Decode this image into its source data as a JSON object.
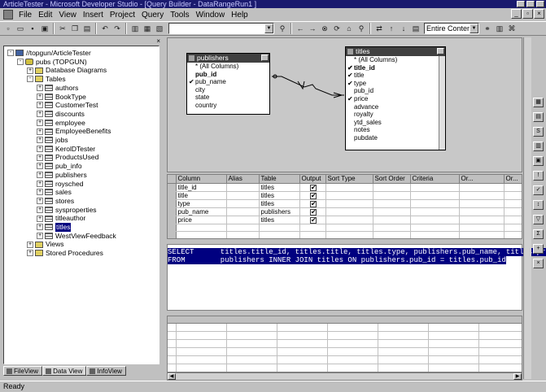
{
  "window": {
    "title": "ArticleTester - Microsoft Developer Studio - [Query Builder - DataRangeRun1 ]"
  },
  "menu": [
    "File",
    "Edit",
    "View",
    "Insert",
    "Project",
    "Query",
    "Tools",
    "Window",
    "Help"
  ],
  "toolbar": {
    "combo_value": "Entire Contents"
  },
  "tree": {
    "root": "//topgun/ArticleTester",
    "db": "pubs (TOPGUN)",
    "diagrams": "Database Diagrams",
    "tables_label": "Tables",
    "tables": [
      "authors",
      "BookType",
      "CustomerTest",
      "discounts",
      "employee",
      "EmployeeBenefits",
      "jobs",
      "KerolDTester",
      "ProductsUsed",
      "pub_info",
      "publishers",
      "roysched",
      "sales",
      "stores",
      "sysproperties",
      "titleauthor",
      "titles",
      "WestViewFeedback"
    ],
    "selected_table": "titles",
    "views": "Views",
    "procs": "Stored Procedures"
  },
  "tabs": [
    "FileView",
    "Data View",
    "InfoView"
  ],
  "diagram": {
    "publishers": {
      "title": "publishers",
      "columns": [
        {
          "name": "* (All Columns)",
          "checked": false,
          "bold": false
        },
        {
          "name": "pub_id",
          "checked": false,
          "bold": true
        },
        {
          "name": "pub_name",
          "checked": true,
          "bold": false
        },
        {
          "name": "city",
          "checked": false,
          "bold": false
        },
        {
          "name": "state",
          "checked": false,
          "bold": false
        },
        {
          "name": "country",
          "checked": false,
          "bold": false
        }
      ]
    },
    "titles": {
      "title": "titles",
      "columns": [
        {
          "name": "* (All Columns)",
          "checked": false,
          "bold": false
        },
        {
          "name": "title_id",
          "checked": true,
          "bold": true
        },
        {
          "name": "title",
          "checked": true,
          "bold": false
        },
        {
          "name": "type",
          "checked": true,
          "bold": false
        },
        {
          "name": "pub_id",
          "checked": false,
          "bold": false
        },
        {
          "name": "price",
          "checked": true,
          "bold": false
        },
        {
          "name": "advance",
          "checked": false,
          "bold": false
        },
        {
          "name": "royalty",
          "checked": false,
          "bold": false
        },
        {
          "name": "ytd_sales",
          "checked": false,
          "bold": false
        },
        {
          "name": "notes",
          "checked": false,
          "bold": false
        },
        {
          "name": "pubdate",
          "checked": false,
          "bold": false
        }
      ]
    }
  },
  "grid": {
    "headers": [
      "Column",
      "Alias",
      "Table",
      "Output",
      "Sort Type",
      "Sort Order",
      "Criteria",
      "Or...",
      "Or..."
    ],
    "rows": [
      {
        "column": "title_id",
        "table": "titles"
      },
      {
        "column": "title",
        "table": "titles"
      },
      {
        "column": "type",
        "table": "titles"
      },
      {
        "column": "pub_name",
        "table": "publishers"
      },
      {
        "column": "price",
        "table": "titles"
      }
    ]
  },
  "sql": {
    "line1": "SELECT      titles.title_id, titles.title, titles.type, publishers.pub_name, titles.price",
    "line2": "FROM        publishers INNER JOIN titles ON publishers.pub_id = titles.pub_id"
  },
  "status": "Ready"
}
